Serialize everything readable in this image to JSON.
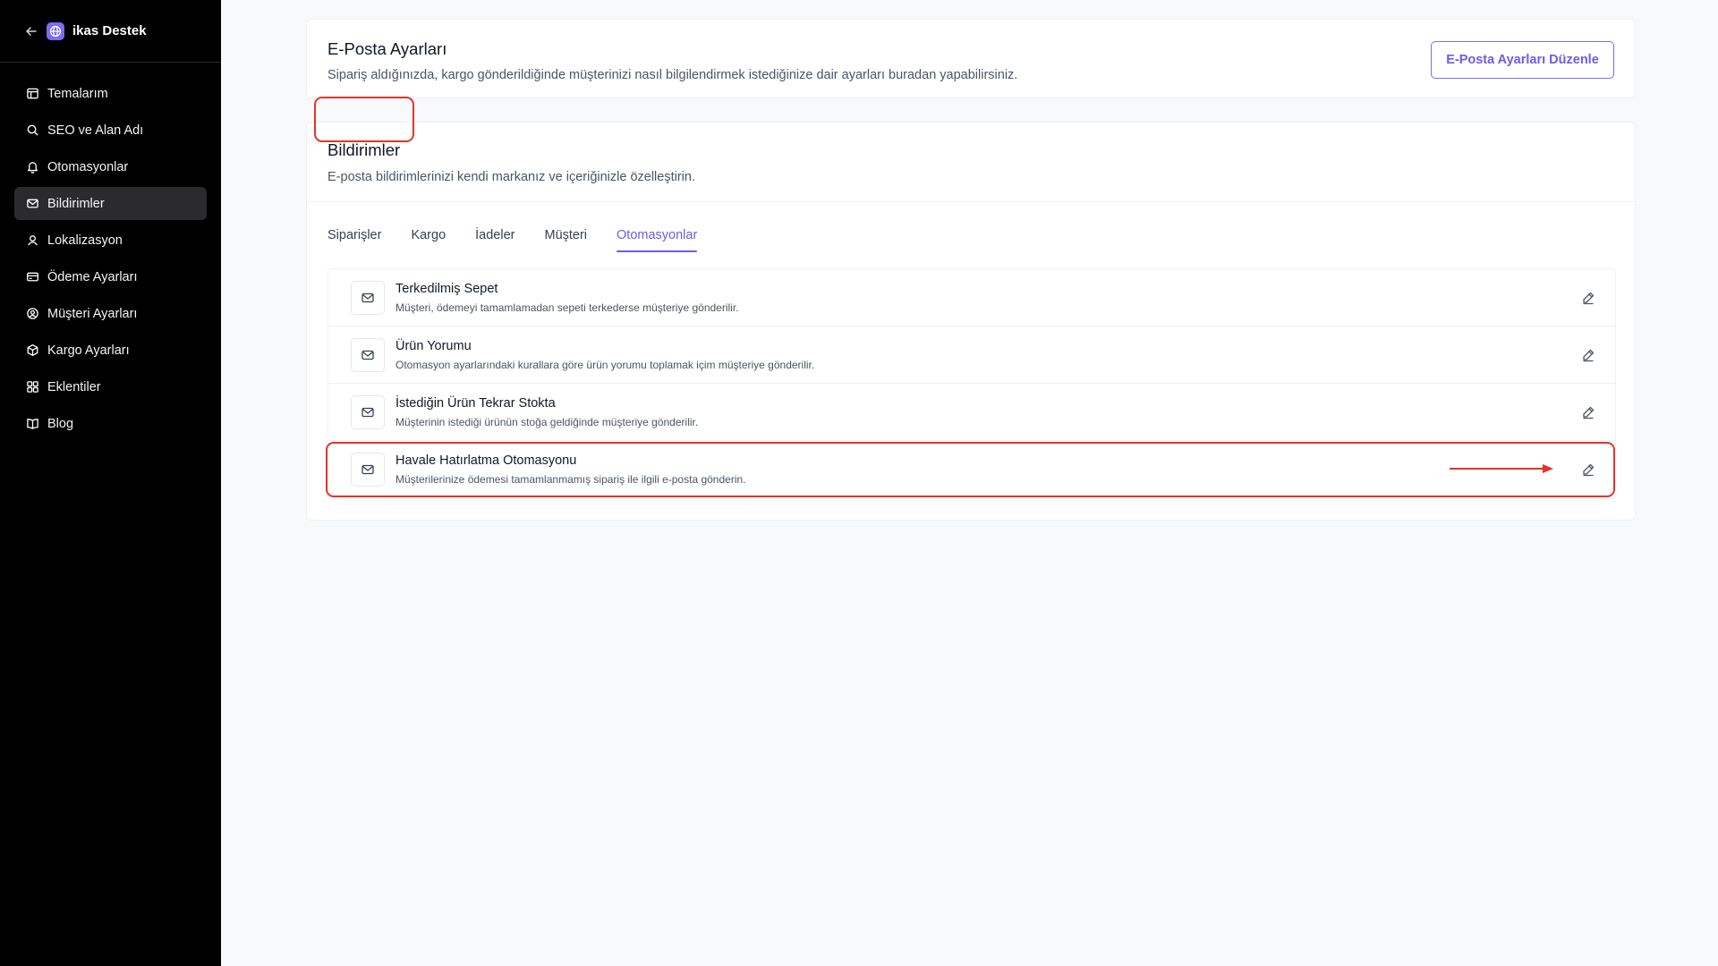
{
  "sidebar": {
    "brand": "ikas Destek",
    "items": [
      {
        "label": "Temalarım",
        "icon": "layout-icon"
      },
      {
        "label": "SEO ve Alan Adı",
        "icon": "search-icon"
      },
      {
        "label": "Otomasyonlar",
        "icon": "bell-icon"
      },
      {
        "label": "Bildirimler",
        "icon": "mail-icon"
      },
      {
        "label": "Lokalizasyon",
        "icon": "location-icon"
      },
      {
        "label": "Ödeme Ayarları",
        "icon": "credit-card-icon"
      },
      {
        "label": "Müşteri Ayarları",
        "icon": "user-circle-icon"
      },
      {
        "label": "Kargo Ayarları",
        "icon": "package-icon"
      },
      {
        "label": "Eklentiler",
        "icon": "grid-icon"
      },
      {
        "label": "Blog",
        "icon": "book-icon"
      }
    ],
    "active_index": 3
  },
  "email_settings": {
    "title": "E-Posta Ayarları",
    "description": "Sipariş aldığınızda, kargo gönderildiğinde müşterinizi nasıl bilgilendirmek istediğinize dair ayarları buradan yapabilirsiniz.",
    "button_label": "E-Posta Ayarları Düzenle"
  },
  "notifications": {
    "title": "Bildirimler",
    "description": "E-posta bildirimlerinizi kendi markanız ve içeriğinizle özelleştirin.",
    "tabs": [
      "Siparişler",
      "Kargo",
      "İadeler",
      "Müşteri",
      "Otomasyonlar"
    ],
    "active_tab": 4,
    "rows": [
      {
        "title": "Terkedilmiş Sepet",
        "description": "Müşteri, ödemeyi tamamlamadan sepeti terkederse müşteriye gönderilir."
      },
      {
        "title": "Ürün Yorumu",
        "description": "Otomasyon ayarlarındaki kurallara göre ürün yorumu toplamak içim müşteriye gönderilir."
      },
      {
        "title": "İstediğin Ürün Tekrar Stokta",
        "description": "Müşterinin istediği ürünün stoğa geldiğinde müşteriye gönderilir."
      },
      {
        "title": "Havale Hatırlatma Otomasyonu",
        "description": "Müşterilerinize ödemesi tamamlanmamış sipariş ile ilgili e-posta gönderin."
      }
    ]
  },
  "colors": {
    "sidebar_bg": "#000000",
    "accent": "#6d5ce8",
    "highlight": "#e5332a"
  }
}
